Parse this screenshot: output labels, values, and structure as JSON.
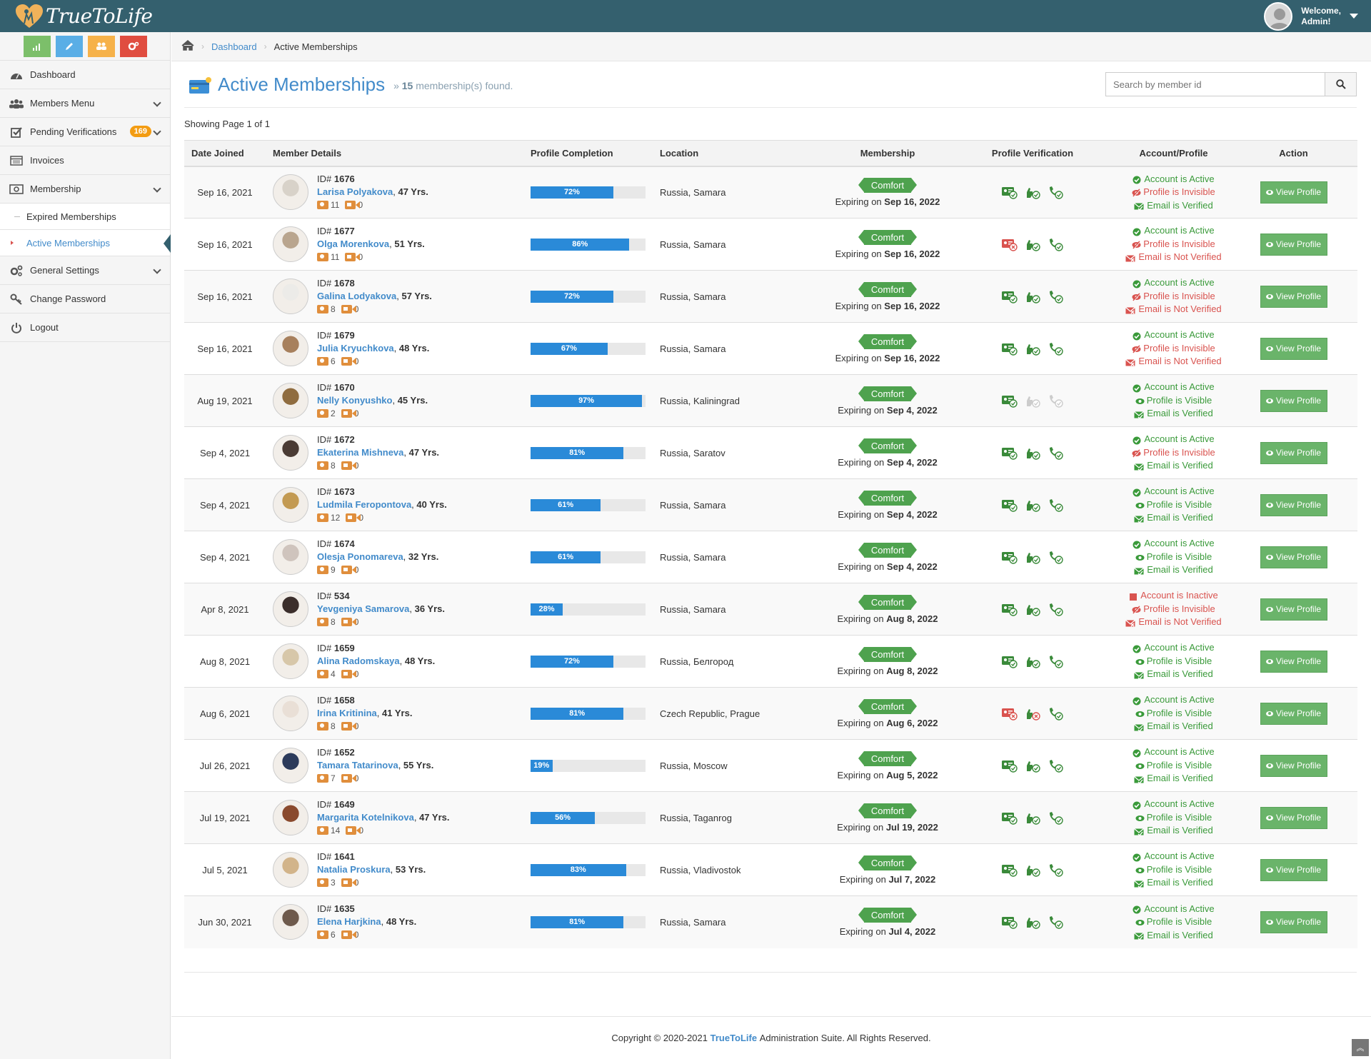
{
  "app": {
    "logo_text": "TrueToLife",
    "welcome_line1": "Welcome,",
    "welcome_line2": "Admin!"
  },
  "colors": {
    "topbar": "#34606e",
    "accent": "#428bca",
    "success": "#4ea24e",
    "danger": "#d9534f",
    "progress": "#2a8ad8"
  },
  "shortcuts": [
    {
      "icon": "bar-chart-icon",
      "color": "#7cbf6a"
    },
    {
      "icon": "pencil-icon",
      "color": "#5aaee6"
    },
    {
      "icon": "users-icon",
      "color": "#f6b24a"
    },
    {
      "icon": "cogs-icon",
      "color": "#e04d40"
    }
  ],
  "sidebar": {
    "dashboard": "Dashboard",
    "members_menu": "Members Menu",
    "pending": "Pending Verifications",
    "pending_badge": "169",
    "invoices": "Invoices",
    "membership": "Membership",
    "expired": "Expired Memberships",
    "active": "Active Memberships",
    "general_settings": "General Settings",
    "change_password": "Change Password",
    "logout": "Logout"
  },
  "breadcrumb": {
    "dashboard": "Dashboard",
    "current": "Active Memberships"
  },
  "header": {
    "title": "Active Memberships",
    "prefix": "»",
    "count": "15",
    "count_suffix": "membership(s) found."
  },
  "search": {
    "placeholder": "Search by member id"
  },
  "showing": "Showing Page 1 of 1",
  "table": {
    "columns": [
      "Date Joined",
      "Member Details",
      "Profile Completion",
      "Location",
      "Membership",
      "Profile Verification",
      "Account/Profile",
      "Action"
    ],
    "view_label": "View Profile",
    "expiring_label": "Expiring on",
    "id_label": "ID#",
    "rows": [
      {
        "date": "Sep 16, 2021",
        "id": "1676",
        "name": "Larisa Polyakova",
        "age": "47 Yrs.",
        "photos": "11",
        "videos": "0",
        "completion": 72,
        "completion_label": "72%",
        "location": "Russia, Samara",
        "plan": "Comfort",
        "expires": "Sep 16, 2022",
        "ver": [
          "ok",
          "ok",
          "ok"
        ],
        "account": "Account is Active",
        "account_ok": true,
        "profile": "Profile is Invisible",
        "profile_ok": false,
        "email": "Email is Verified",
        "email_ok": true,
        "photo_color": "#d8d2c9"
      },
      {
        "date": "Sep 16, 2021",
        "id": "1677",
        "name": "Olga Morenkova",
        "age": "51 Yrs.",
        "photos": "11",
        "videos": "0",
        "completion": 86,
        "completion_label": "86%",
        "location": "Russia, Samara",
        "plan": "Comfort",
        "expires": "Sep 16, 2022",
        "ver": [
          "bad",
          "ok",
          "ok"
        ],
        "account": "Account is Active",
        "account_ok": true,
        "profile": "Profile is Invisible",
        "profile_ok": false,
        "email": "Email is Not Verified",
        "email_ok": false,
        "photo_color": "#b9a58e"
      },
      {
        "date": "Sep 16, 2021",
        "id": "1678",
        "name": "Galina Lodyakova",
        "age": "57 Yrs.",
        "photos": "8",
        "videos": "0",
        "completion": 72,
        "completion_label": "72%",
        "location": "Russia, Samara",
        "plan": "Comfort",
        "expires": "Sep 16, 2022",
        "ver": [
          "ok",
          "ok",
          "ok"
        ],
        "account": "Account is Active",
        "account_ok": true,
        "profile": "Profile is Invisible",
        "profile_ok": false,
        "email": "Email is Not Verified",
        "email_ok": false,
        "photo_color": "#ecebe8"
      },
      {
        "date": "Sep 16, 2021",
        "id": "1679",
        "name": "Julia Kryuchkova",
        "age": "48 Yrs.",
        "photos": "6",
        "videos": "0",
        "completion": 67,
        "completion_label": "67%",
        "location": "Russia, Samara",
        "plan": "Comfort",
        "expires": "Sep 16, 2022",
        "ver": [
          "ok",
          "ok",
          "ok"
        ],
        "account": "Account is Active",
        "account_ok": true,
        "profile": "Profile is Invisible",
        "profile_ok": false,
        "email": "Email is Not Verified",
        "email_ok": false,
        "photo_color": "#a7805d"
      },
      {
        "date": "Aug 19, 2021",
        "id": "1670",
        "name": "Nelly Konyushko",
        "age": "45 Yrs.",
        "photos": "2",
        "videos": "0",
        "completion": 97,
        "completion_label": "97%",
        "location": "Russia, Kaliningrad",
        "plan": "Comfort",
        "expires": "Sep 4, 2022",
        "ver": [
          "ok",
          "off",
          "off"
        ],
        "account": "Account is Active",
        "account_ok": true,
        "profile": "Profile is Visible",
        "profile_ok": true,
        "email": "Email is Verified",
        "email_ok": true,
        "photo_color": "#8f6c3f"
      },
      {
        "date": "Sep 4, 2021",
        "id": "1672",
        "name": "Ekaterina Mishneva",
        "age": "47 Yrs.",
        "photos": "8",
        "videos": "0",
        "completion": 81,
        "completion_label": "81%",
        "location": "Russia, Saratov",
        "plan": "Comfort",
        "expires": "Sep 4, 2022",
        "ver": [
          "ok",
          "ok",
          "ok"
        ],
        "account": "Account is Active",
        "account_ok": true,
        "profile": "Profile is Invisible",
        "profile_ok": false,
        "email": "Email is Verified",
        "email_ok": true,
        "photo_color": "#4a3b34"
      },
      {
        "date": "Sep 4, 2021",
        "id": "1673",
        "name": "Ludmila Feropontova",
        "age": "40 Yrs.",
        "photos": "12",
        "videos": "0",
        "completion": 61,
        "completion_label": "61%",
        "location": "Russia, Samara",
        "plan": "Comfort",
        "expires": "Sep 4, 2022",
        "ver": [
          "ok",
          "ok",
          "ok"
        ],
        "account": "Account is Active",
        "account_ok": true,
        "profile": "Profile is Visible",
        "profile_ok": true,
        "email": "Email is Verified",
        "email_ok": true,
        "photo_color": "#c39a52"
      },
      {
        "date": "Sep 4, 2021",
        "id": "1674",
        "name": "Olesja Ponomareva",
        "age": "32 Yrs.",
        "photos": "9",
        "videos": "0",
        "completion": 61,
        "completion_label": "61%",
        "location": "Russia, Samara",
        "plan": "Comfort",
        "expires": "Sep 4, 2022",
        "ver": [
          "ok",
          "ok",
          "ok"
        ],
        "account": "Account is Active",
        "account_ok": true,
        "profile": "Profile is Visible",
        "profile_ok": true,
        "email": "Email is Verified",
        "email_ok": true,
        "photo_color": "#cfc4bd"
      },
      {
        "date": "Apr 8, 2021",
        "id": "534",
        "name": "Yevgeniya Samarova",
        "age": "36 Yrs.",
        "photos": "8",
        "videos": "0",
        "completion": 28,
        "completion_label": "28%",
        "location": "Russia, Samara",
        "plan": "Comfort",
        "expires": "Aug 8, 2022",
        "ver": [
          "ok",
          "ok",
          "ok"
        ],
        "account": "Account is Inactive",
        "account_ok": false,
        "profile": "Profile is Invisible",
        "profile_ok": false,
        "email": "Email is Not Verified",
        "email_ok": false,
        "photo_color": "#3b2e2b"
      },
      {
        "date": "Aug 8, 2021",
        "id": "1659",
        "name": "Alina Radomskaya",
        "age": "48 Yrs.",
        "photos": "4",
        "videos": "0",
        "completion": 72,
        "completion_label": "72%",
        "location": "Russia, Белгород",
        "plan": "Comfort",
        "expires": "Aug 8, 2022",
        "ver": [
          "ok",
          "ok",
          "ok"
        ],
        "account": "Account is Active",
        "account_ok": true,
        "profile": "Profile is Visible",
        "profile_ok": true,
        "email": "Email is Verified",
        "email_ok": true,
        "photo_color": "#d7c7a9"
      },
      {
        "date": "Aug 6, 2021",
        "id": "1658",
        "name": "Irina Kritinina",
        "age": "41 Yrs.",
        "photos": "8",
        "videos": "0",
        "completion": 81,
        "completion_label": "81%",
        "location": "Czech Republic, Prague",
        "plan": "Comfort",
        "expires": "Aug 6, 2022",
        "ver": [
          "bad",
          "bad",
          "ok"
        ],
        "account": "Account is Active",
        "account_ok": true,
        "profile": "Profile is Visible",
        "profile_ok": true,
        "email": "Email is Verified",
        "email_ok": true,
        "photo_color": "#e9dfd6"
      },
      {
        "date": "Jul 26, 2021",
        "id": "1652",
        "name": "Tamara Tatarinova",
        "age": "55 Yrs.",
        "photos": "7",
        "videos": "0",
        "completion": 19,
        "completion_label": "19%",
        "location": "Russia, Moscow",
        "plan": "Comfort",
        "expires": "Aug 5, 2022",
        "ver": [
          "ok",
          "ok",
          "ok"
        ],
        "account": "Account is Active",
        "account_ok": true,
        "profile": "Profile is Visible",
        "profile_ok": true,
        "email": "Email is Verified",
        "email_ok": true,
        "photo_color": "#2c3a5a"
      },
      {
        "date": "Jul 19, 2021",
        "id": "1649",
        "name": "Margarita Kotelnikova",
        "age": "47 Yrs.",
        "photos": "14",
        "videos": "0",
        "completion": 56,
        "completion_label": "56%",
        "location": "Russia, Taganrog",
        "plan": "Comfort",
        "expires": "Jul 19, 2022",
        "ver": [
          "ok",
          "ok",
          "ok"
        ],
        "account": "Account is Active",
        "account_ok": true,
        "profile": "Profile is Visible",
        "profile_ok": true,
        "email": "Email is Verified",
        "email_ok": true,
        "photo_color": "#8a4a2e"
      },
      {
        "date": "Jul 5, 2021",
        "id": "1641",
        "name": "Natalia Proskura",
        "age": "53 Yrs.",
        "photos": "3",
        "videos": "0",
        "completion": 83,
        "completion_label": "83%",
        "location": "Russia, Vladivostok",
        "plan": "Comfort",
        "expires": "Jul 7, 2022",
        "ver": [
          "ok",
          "ok",
          "ok"
        ],
        "account": "Account is Active",
        "account_ok": true,
        "profile": "Profile is Visible",
        "profile_ok": true,
        "email": "Email is Verified",
        "email_ok": true,
        "photo_color": "#d2b48a"
      },
      {
        "date": "Jun 30, 2021",
        "id": "1635",
        "name": "Elena Harjkina",
        "age": "48 Yrs.",
        "photos": "6",
        "videos": "0",
        "completion": 81,
        "completion_label": "81%",
        "location": "Russia, Samara",
        "plan": "Comfort",
        "expires": "Jul 4, 2022",
        "ver": [
          "ok",
          "ok",
          "ok"
        ],
        "account": "Account is Active",
        "account_ok": true,
        "profile": "Profile is Visible",
        "profile_ok": true,
        "email": "Email is Verified",
        "email_ok": true,
        "photo_color": "#6e5a4c"
      }
    ]
  },
  "footer": {
    "prefix": "Copyright © 2020-2021",
    "brand": "TrueToLife",
    "suffix": "Administration Suite. All Rights Reserved."
  }
}
